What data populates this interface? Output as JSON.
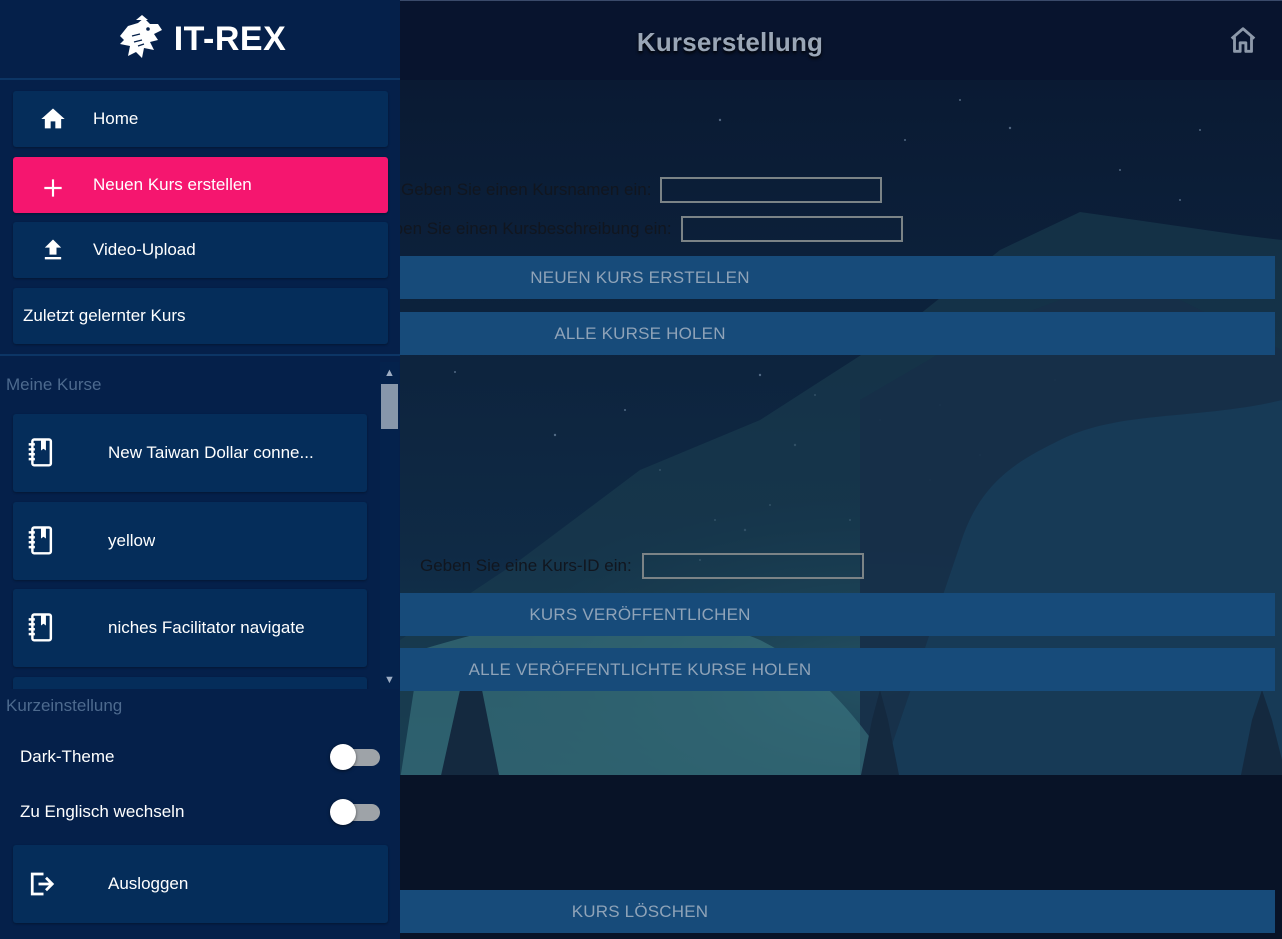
{
  "app": {
    "name": "IT-REX"
  },
  "header": {
    "title": "Kurserstellung",
    "home_icon": "home-icon"
  },
  "nav": {
    "items": [
      {
        "label": "Home",
        "icon": "home-icon",
        "active": false
      },
      {
        "label": "Neuen Kurs erstellen",
        "icon": "plus-icon",
        "active": true
      },
      {
        "label": "Video-Upload",
        "icon": "upload-icon",
        "active": false
      },
      {
        "label": "Zuletzt gelernter Kurs",
        "icon": "",
        "active": false
      }
    ]
  },
  "my_courses": {
    "heading": "Meine Kurse",
    "items": [
      {
        "label": "New Taiwan Dollar conne...",
        "icon": "notebook-icon"
      },
      {
        "label": "yellow",
        "icon": "notebook-icon"
      },
      {
        "label": "niches Facilitator navigate",
        "icon": "notebook-icon"
      }
    ]
  },
  "settings": {
    "heading": "Kurzeinstellung",
    "dark_theme_label": "Dark-Theme",
    "dark_theme_on": false,
    "english_label": "Zu Englisch wechseln",
    "english_on": false
  },
  "logout": {
    "label": "Ausloggen",
    "icon": "logout-icon"
  },
  "form": {
    "course_name_label": "Geben Sie einen Kursnamen ein:",
    "course_name_value": "",
    "course_desc_label": "Geben Sie einen Kursbeschreibung ein:",
    "course_desc_value": "",
    "create_button": "NEUEN KURS ERSTELLEN",
    "get_all_button": "ALLE KURSE HOLEN",
    "course_id_label": "Geben Sie eine Kurs-ID ein:",
    "course_id_value": "",
    "publish_button": "KURS VERÖFFENTLICHEN",
    "get_published_button": "ALLE VERÖFFENTLICHTE KURSE HOLEN",
    "delete_button": "KURS LÖSCHEN"
  },
  "colors": {
    "drawer_bg": "#05204a",
    "nav_item_bg": "#052d5a",
    "active_accent": "#f5166f",
    "action_button_bg": "#174b7a",
    "header_bg": "#08142e"
  }
}
